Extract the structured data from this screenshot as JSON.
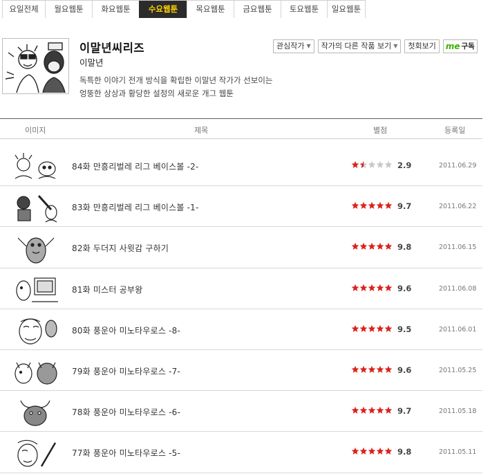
{
  "tabs": [
    {
      "label": "요일전체",
      "active": false
    },
    {
      "label": "월요웹툰",
      "active": false
    },
    {
      "label": "화요웹툰",
      "active": false
    },
    {
      "label": "수요웹툰",
      "active": true
    },
    {
      "label": "목요웹툰",
      "active": false
    },
    {
      "label": "금요웹툰",
      "active": false
    },
    {
      "label": "토요웹툰",
      "active": false
    },
    {
      "label": "일요웹툰",
      "active": false
    }
  ],
  "series": {
    "title": "이말년씨리즈",
    "author": "이말년",
    "description_line1": "독특한 이야기 전개 방식을 확립한 이말년 작가가 선보이는",
    "description_line2": "엉뚱한 상상과 황당한 설정의 새로운 개그 웹툰"
  },
  "actions": {
    "favorite_label": "관심작가",
    "other_works_label": "작가의 다른 작품 보기",
    "first_episode_label": "첫회보기",
    "me_logo": "me",
    "subscribe_label": "구독"
  },
  "list_header": {
    "image": "이미지",
    "title": "제목",
    "rating": "별점",
    "date": "등록일"
  },
  "episodes": [
    {
      "title": "84화 만흥리벌레 리그 베이스볼 -2-",
      "stars": 1.5,
      "score": "2.9",
      "date": "2011.06.29"
    },
    {
      "title": "83화 만흥리벌레 리그 베이스볼 -1-",
      "stars": 5,
      "score": "9.7",
      "date": "2011.06.22"
    },
    {
      "title": "82화 두더지 사윗감 구하기",
      "stars": 5,
      "score": "9.8",
      "date": "2011.06.15"
    },
    {
      "title": "81화 미스터 공부왕",
      "stars": 5,
      "score": "9.6",
      "date": "2011.06.08"
    },
    {
      "title": "80화 풍운아 미노타우로스 -8-",
      "stars": 5,
      "score": "9.5",
      "date": "2011.06.01"
    },
    {
      "title": "79화 풍운아 미노타우로스 -7-",
      "stars": 5,
      "score": "9.6",
      "date": "2011.05.25"
    },
    {
      "title": "78화 풍운아 미노타우로스 -6-",
      "stars": 5,
      "score": "9.7",
      "date": "2011.05.18"
    },
    {
      "title": "77화 풍운아 미노타우로스 -5-",
      "stars": 5,
      "score": "9.8",
      "date": "2011.05.11"
    }
  ],
  "colors": {
    "active_tab_bg": "#2b2b2b",
    "active_tab_text": "#ffd200",
    "star_on": "#d9231d",
    "star_off": "#c8c8c8",
    "me_green": "#3bb300"
  }
}
